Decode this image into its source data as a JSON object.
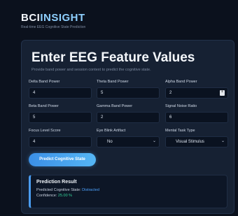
{
  "header": {
    "brand_part1": "BCI",
    "brand_part2": "INSIGHT",
    "tagline": "Real-time EEG Cognitive State Prediction"
  },
  "form": {
    "title": "Enter EEG Feature Values",
    "subtitle": "Provide band power and session context to predict the cognitive state.",
    "fields": [
      {
        "label": "Delta Band Power",
        "value": "4"
      },
      {
        "label": "Theta Band Power",
        "value": "5"
      },
      {
        "label": "Alpha Band Power",
        "value": "2"
      },
      {
        "label": "Beta Band Power",
        "value": "5"
      },
      {
        "label": "Gamma Band Power",
        "value": "2"
      },
      {
        "label": "Signal Noise Ratio",
        "value": "6"
      },
      {
        "label": "Focus Level Score",
        "value": "4"
      },
      {
        "label": "Eye Blink Artifact",
        "value": "No"
      },
      {
        "label": "Mental Task Type",
        "value": "Visual Stimulus"
      }
    ],
    "predict_label": "Predict Cognitive State"
  },
  "result": {
    "title": "Prediction Result",
    "state_label": "Predicted Cognitive State:",
    "state_value": "Distracted",
    "confidence_label": "Confidence:",
    "confidence_value": "25.00 %"
  },
  "colors": {
    "accent": "#4da3ff",
    "confidence": "#34d399",
    "background": "#0b111d",
    "card": "#162133"
  }
}
